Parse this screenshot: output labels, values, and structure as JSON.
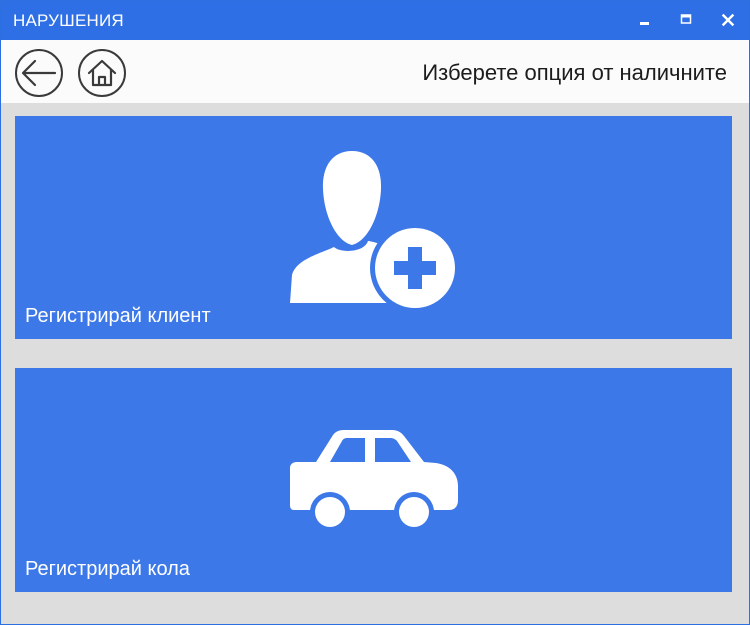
{
  "window": {
    "title": "НАРУШЕНИЯ",
    "accent_color": "#2e6fe5",
    "controls": [
      "minimize-icon",
      "maximize-icon",
      "close-icon"
    ]
  },
  "navbar": {
    "back_icon": "arrow-left-icon",
    "home_icon": "home-icon",
    "hint": "Изберете опция от наличните"
  },
  "tiles": [
    {
      "label": "Регистрирай клиент",
      "icon": "add-user-icon",
      "color": "#3d78e8"
    },
    {
      "label": "Регистрирай кола",
      "icon": "car-icon",
      "color": "#3d78e8"
    }
  ]
}
